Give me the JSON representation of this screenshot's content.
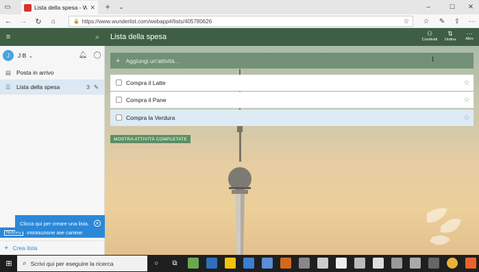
{
  "browser": {
    "tab_title": "Lista della spesa - Wunderlist",
    "url": "https://www.wunderlist.com/webapp#/lists/405780626"
  },
  "sidebar": {
    "user_initial": "J",
    "user_name": "J B",
    "items": [
      {
        "label": "Posta in arrivo",
        "count": ""
      },
      {
        "label": "Lista della spesa",
        "count": "3"
      }
    ],
    "intro_badge": "NUOVO",
    "intro_text": "Introduzione alle cartelle",
    "create_list": "Crea lista"
  },
  "main": {
    "list_title": "Lista della spesa",
    "actions": [
      {
        "label": "Condividi"
      },
      {
        "label": "Ordina"
      },
      {
        "label": "Altro"
      }
    ],
    "add_placeholder": "Aggiungi un'attività...",
    "tasks": [
      "Compra il Latte",
      "Compra il Pane",
      "Compra la Verdura"
    ],
    "show_completed": "MOSTRA ATTIVITÀ COMPLETATE"
  },
  "toast": {
    "text": "Clicca qui per creare una lista."
  },
  "taskbar": {
    "search_placeholder": "Scrivi qui per eseguire la ricerca"
  },
  "colors": {
    "header_green": "#3f5f45",
    "accent_blue": "#2b88d8",
    "done_button": "#5b8f62"
  }
}
